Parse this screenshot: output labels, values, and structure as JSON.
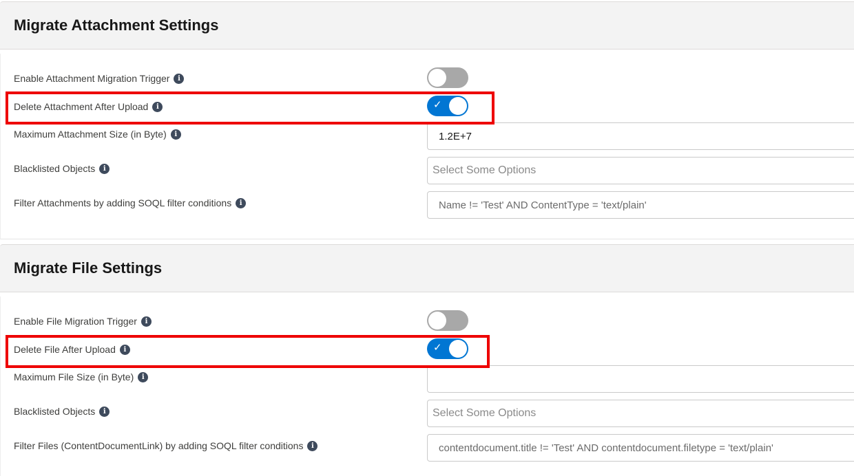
{
  "attachment": {
    "title": "Migrate Attachment Settings",
    "enable_trigger_label": "Enable Attachment Migration Trigger",
    "delete_after_upload_label": "Delete Attachment After Upload",
    "max_size_label": "Maximum Attachment Size (in Byte)",
    "max_size_value": "1.2E+7",
    "blacklisted_label": "Blacklisted Objects",
    "blacklisted_placeholder": "Select Some Options",
    "filter_label": "Filter Attachments by adding SOQL filter conditions",
    "filter_placeholder": "Name != 'Test' AND ContentType = 'text/plain'",
    "enable_trigger_state": "off",
    "delete_after_upload_state": "on"
  },
  "file": {
    "title": "Migrate File Settings",
    "enable_trigger_label": "Enable File Migration Trigger",
    "delete_after_upload_label": "Delete File After Upload",
    "max_size_label": "Maximum File Size (in Byte)",
    "max_size_value": "",
    "blacklisted_label": "Blacklisted Objects",
    "blacklisted_placeholder": "Select Some Options",
    "filter_label": "Filter Files (ContentDocumentLink) by adding SOQL filter conditions",
    "filter_placeholder": "contentdocument.title != 'Test' AND contentdocument.filetype = 'text/plain'",
    "enable_trigger_state": "off",
    "delete_after_upload_state": "on"
  },
  "icons": {
    "info": "i",
    "check": "✓"
  },
  "colors": {
    "toggle_on": "#0176d3",
    "toggle_off": "#a8a8a8",
    "highlight": "#ee0000"
  }
}
